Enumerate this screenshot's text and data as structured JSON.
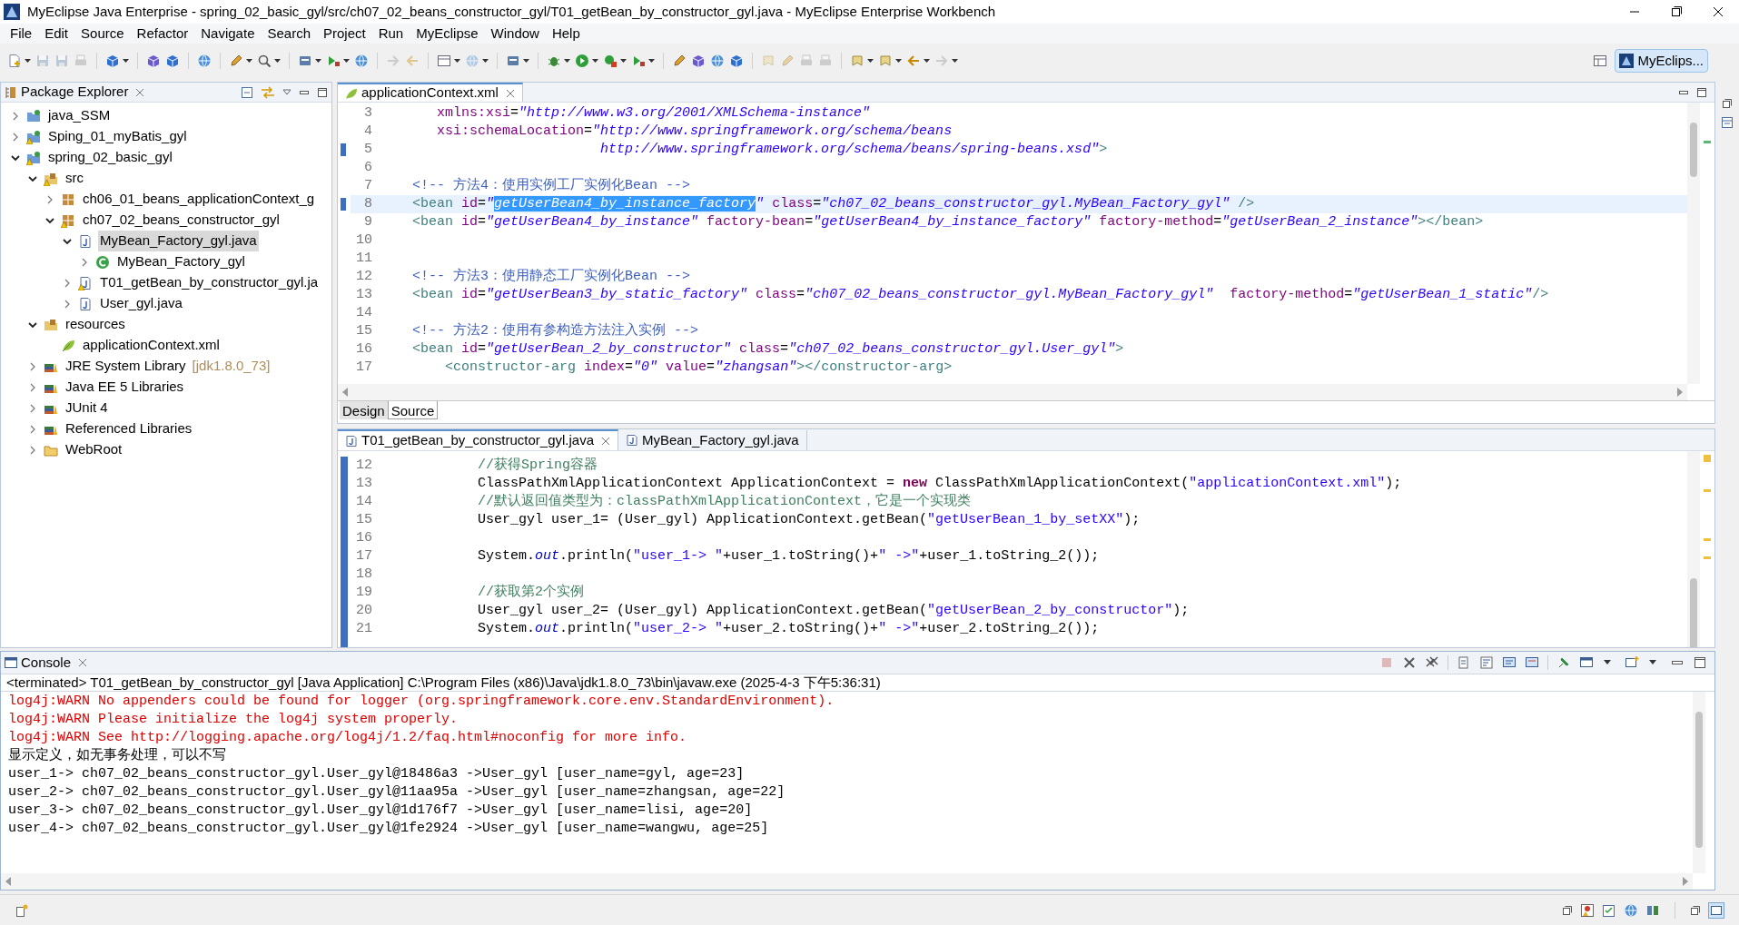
{
  "window": {
    "title": "MyEclipse Java Enterprise - spring_02_basic_gyl/src/ch07_02_beans_constructor_gyl/T01_getBean_by_constructor_gyl.java - MyEclipse Enterprise Workbench"
  },
  "menu": [
    "File",
    "Edit",
    "Source",
    "Refactor",
    "Navigate",
    "Search",
    "Project",
    "Run",
    "MyEclipse",
    "Window",
    "Help"
  ],
  "perspective": {
    "label": "MyEclips...",
    "selected": true
  },
  "package_explorer": {
    "title": "Package Explorer",
    "tree": [
      {
        "label": "java_SSM",
        "kind": "project",
        "warning": false,
        "expanded": false,
        "selected": false
      },
      {
        "label": "Sping_01_myBatis_gyl",
        "kind": "project",
        "warning": true,
        "expanded": false,
        "selected": false
      },
      {
        "label": "spring_02_basic_gyl",
        "kind": "project",
        "warning": true,
        "expanded": true,
        "selected": false,
        "children": [
          {
            "label": "src",
            "kind": "source_folder",
            "warning": true,
            "expanded": true,
            "selected": false,
            "children": [
              {
                "label": "ch06_01_beans_applicationContext_g",
                "kind": "package",
                "warning": false,
                "expanded": false,
                "selected": false
              },
              {
                "label": "ch07_02_beans_constructor_gyl",
                "kind": "package",
                "warning": true,
                "expanded": true,
                "selected": false,
                "children": [
                  {
                    "label": "MyBean_Factory_gyl.java",
                    "kind": "java_file",
                    "warning": false,
                    "expanded": true,
                    "selected": true,
                    "children": [
                      {
                        "label": "MyBean_Factory_gyl",
                        "kind": "class",
                        "warning": false,
                        "expanded": false,
                        "selected": false
                      }
                    ]
                  },
                  {
                    "label": "T01_getBean_by_constructor_gyl.ja",
                    "kind": "java_file",
                    "warning": true,
                    "expanded": false,
                    "selected": false
                  },
                  {
                    "label": "User_gyl.java",
                    "kind": "java_file",
                    "warning": false,
                    "expanded": false,
                    "selected": false
                  }
                ]
              }
            ]
          },
          {
            "label": "resources",
            "kind": "source_folder",
            "warning": false,
            "expanded": true,
            "selected": false,
            "children": [
              {
                "label": "applicationContext.xml",
                "kind": "xml_file",
                "warning": false,
                "selected": false
              }
            ]
          },
          {
            "label": "JRE System Library",
            "suffix": "[jdk1.8.0_73]",
            "kind": "library",
            "warning": false,
            "expanded": false,
            "selected": false
          },
          {
            "label": "Java EE 5 Libraries",
            "kind": "library",
            "warning": false,
            "expanded": false,
            "selected": false
          },
          {
            "label": "JUnit 4",
            "kind": "library",
            "warning": false,
            "expanded": false,
            "selected": false
          },
          {
            "label": "Referenced Libraries",
            "kind": "library",
            "warning": false,
            "expanded": false,
            "selected": false
          },
          {
            "label": "WebRoot",
            "kind": "folder",
            "warning": false,
            "expanded": false,
            "selected": false
          }
        ]
      }
    ]
  },
  "xml_editor": {
    "tab": {
      "label": "applicationContext.xml",
      "selected": true
    },
    "lines": [
      {
        "number": "3",
        "current": false,
        "marked": false,
        "tokens": [
          {
            "kind": "attr",
            "text": "       xmlns:xsi"
          },
          {
            "kind": "plain",
            "text": "="
          },
          {
            "kind": "string",
            "text": "\"http://www.w3.org/2001/XMLSchema-instance\""
          }
        ]
      },
      {
        "number": "4",
        "current": false,
        "marked": false,
        "tokens": [
          {
            "kind": "attr",
            "text": "       xsi:schemaLocation"
          },
          {
            "kind": "plain",
            "text": "="
          },
          {
            "kind": "string",
            "text": "\"http://www.springframework.org/schema/beans"
          }
        ]
      },
      {
        "number": "5",
        "current": false,
        "marked": true,
        "tokens": [
          {
            "kind": "string",
            "text": "                           http://www.springframework.org/schema/beans/spring-beans.xsd\""
          },
          {
            "kind": "tag",
            "text": ">"
          }
        ]
      },
      {
        "number": "6",
        "current": false,
        "marked": false
      },
      {
        "number": "7",
        "current": false,
        "marked": false,
        "tokens": [
          {
            "kind": "comment",
            "text": "    <!-- 方法4：使用实例工厂实例化Bean -->"
          }
        ]
      },
      {
        "number": "8",
        "current": true,
        "marked": true,
        "tokens": [
          {
            "kind": "tag",
            "text": "    <bean"
          },
          {
            "kind": "attr",
            "text": " id"
          },
          {
            "kind": "plain",
            "text": "="
          },
          {
            "kind": "string",
            "text": "\""
          },
          {
            "kind": "selection",
            "text": "getUserBean4_by_instance_factory"
          },
          {
            "kind": "string",
            "text": "\""
          },
          {
            "kind": "attr",
            "text": " class"
          },
          {
            "kind": "plain",
            "text": "="
          },
          {
            "kind": "string",
            "text": "\"ch07_02_beans_constructor_gyl.MyBean_Factory_gyl\""
          },
          {
            "kind": "tag",
            "text": " />"
          }
        ]
      },
      {
        "number": "9",
        "current": false,
        "marked": false,
        "tokens": [
          {
            "kind": "tag",
            "text": "    <bean"
          },
          {
            "kind": "attr",
            "text": " id"
          },
          {
            "kind": "plain",
            "text": "="
          },
          {
            "kind": "string",
            "text": "\"getUserBean4_by_instance\""
          },
          {
            "kind": "attr",
            "text": " factory-bean"
          },
          {
            "kind": "plain",
            "text": "="
          },
          {
            "kind": "string",
            "text": "\"getUserBean4_by_instance_factory\""
          },
          {
            "kind": "attr",
            "text": " factory-method"
          },
          {
            "kind": "plain",
            "text": "="
          },
          {
            "kind": "string",
            "text": "\"getUserBean_2_instance\""
          },
          {
            "kind": "tag",
            "text": "></bean>"
          }
        ]
      },
      {
        "number": "10",
        "current": false,
        "marked": false
      },
      {
        "number": "11",
        "current": false,
        "marked": false
      },
      {
        "number": "12",
        "current": false,
        "marked": false,
        "tokens": [
          {
            "kind": "comment",
            "text": "    <!-- 方法3：使用静态工厂实例化Bean -->"
          }
        ]
      },
      {
        "number": "13",
        "current": false,
        "marked": false,
        "tokens": [
          {
            "kind": "tag",
            "text": "    <bean"
          },
          {
            "kind": "attr",
            "text": " id"
          },
          {
            "kind": "plain",
            "text": "="
          },
          {
            "kind": "string",
            "text": "\"getUserBean3_by_static_factory\""
          },
          {
            "kind": "attr",
            "text": " class"
          },
          {
            "kind": "plain",
            "text": "="
          },
          {
            "kind": "string",
            "text": "\"ch07_02_beans_constructor_gyl.MyBean_Factory_gyl\""
          },
          {
            "kind": "attr",
            "text": "  factory-method"
          },
          {
            "kind": "plain",
            "text": "="
          },
          {
            "kind": "string",
            "text": "\"getUserBean_1_static\""
          },
          {
            "kind": "tag",
            "text": "/>"
          }
        ]
      },
      {
        "number": "14",
        "current": false,
        "marked": false
      },
      {
        "number": "15",
        "current": false,
        "marked": false,
        "tokens": [
          {
            "kind": "comment",
            "text": "    <!-- 方法2：使用有参构造方法注入实例 -->"
          }
        ]
      },
      {
        "number": "16",
        "current": false,
        "marked": false,
        "tokens": [
          {
            "kind": "tag",
            "text": "    <bean"
          },
          {
            "kind": "attr",
            "text": " id"
          },
          {
            "kind": "plain",
            "text": "="
          },
          {
            "kind": "string",
            "text": "\"getUserBean_2_by_constructor\""
          },
          {
            "kind": "attr",
            "text": " class"
          },
          {
            "kind": "plain",
            "text": "="
          },
          {
            "kind": "string",
            "text": "\"ch07_02_beans_constructor_gyl.User_gyl\""
          },
          {
            "kind": "tag",
            "text": ">"
          }
        ]
      },
      {
        "number": "17",
        "current": false,
        "marked": false,
        "tokens": [
          {
            "kind": "tag",
            "text": "        <constructor-arg"
          },
          {
            "kind": "attr",
            "text": " index"
          },
          {
            "kind": "plain",
            "text": "="
          },
          {
            "kind": "string",
            "text": "\"0\""
          },
          {
            "kind": "attr",
            "text": " value"
          },
          {
            "kind": "plain",
            "text": "="
          },
          {
            "kind": "string",
            "text": "\"zhangsan\""
          },
          {
            "kind": "tag",
            "text": "></constructor-arg>"
          }
        ]
      }
    ],
    "bottom_tabs": [
      {
        "label": "Design",
        "selected": false
      },
      {
        "label": "Source",
        "selected": true
      }
    ]
  },
  "java_editor": {
    "tabs": [
      {
        "label": "T01_getBean_by_constructor_gyl.java",
        "selected": true
      },
      {
        "label": "MyBean_Factory_gyl.java",
        "selected": false
      }
    ],
    "lines": [
      {
        "number": "12",
        "tokens": [
          {
            "kind": "comment",
            "text": "            //获得Spring容器"
          }
        ]
      },
      {
        "number": "13",
        "tokens": [
          {
            "kind": "plain",
            "text": "            ClassPathXmlApplicationContext ApplicationContext = "
          },
          {
            "kind": "keyword",
            "text": "new"
          },
          {
            "kind": "plain",
            "text": " ClassPathXmlApplicationContext("
          },
          {
            "kind": "string",
            "text": "\"applicationContext.xml\""
          },
          {
            "kind": "plain",
            "text": ");"
          }
        ]
      },
      {
        "number": "14",
        "tokens": [
          {
            "kind": "comment",
            "text": "            //默认返回值类型为：classPathXmlApplicationContext，它是一个实现类"
          }
        ]
      },
      {
        "number": "15",
        "tokens": [
          {
            "kind": "plain",
            "text": "            User_gyl user_1= (User_gyl) ApplicationContext.getBean("
          },
          {
            "kind": "string",
            "text": "\"getUserBean_1_by_setXX\""
          },
          {
            "kind": "plain",
            "text": ");"
          }
        ]
      },
      {
        "number": "16"
      },
      {
        "number": "17",
        "tokens": [
          {
            "kind": "plain",
            "text": "            System."
          },
          {
            "kind": "field",
            "text": "out"
          },
          {
            "kind": "plain",
            "text": ".println("
          },
          {
            "kind": "string",
            "text": "\"user_1-> \""
          },
          {
            "kind": "plain",
            "text": "+user_1.toString()+"
          },
          {
            "kind": "string",
            "text": "\" ->\""
          },
          {
            "kind": "plain",
            "text": "+user_1.toString_2());"
          }
        ]
      },
      {
        "number": "18"
      },
      {
        "number": "19",
        "tokens": [
          {
            "kind": "comment",
            "text": "            //获取第2个实例"
          }
        ]
      },
      {
        "number": "20",
        "tokens": [
          {
            "kind": "plain",
            "text": "            User_gyl user_2= (User_gyl) ApplicationContext.getBean("
          },
          {
            "kind": "string",
            "text": "\"getUserBean_2_by_constructor\""
          },
          {
            "kind": "plain",
            "text": ");"
          }
        ]
      },
      {
        "number": "21",
        "tokens": [
          {
            "kind": "plain",
            "text": "            System."
          },
          {
            "kind": "field",
            "text": "out"
          },
          {
            "kind": "plain",
            "text": ".println("
          },
          {
            "kind": "string",
            "text": "\"user_2-> \""
          },
          {
            "kind": "plain",
            "text": "+user_2.toString()+"
          },
          {
            "kind": "string",
            "text": "\" ->\""
          },
          {
            "kind": "plain",
            "text": "+user_2.toString_2());"
          }
        ]
      }
    ]
  },
  "console": {
    "title": "Console",
    "status": "<terminated> T01_getBean_by_constructor_gyl [Java Application] C:\\Program Files (x86)\\Java\\jdk1.8.0_73\\bin\\javaw.exe (2025-4-3 下午5:36:31)",
    "lines": [
      {
        "kind": "error",
        "text": "log4j:WARN No appenders could be found for logger (org.springframework.core.env.StandardEnvironment)."
      },
      {
        "kind": "error",
        "text": "log4j:WARN Please initialize the log4j system properly."
      },
      {
        "kind": "error",
        "text": "log4j:WARN See http://logging.apache.org/log4j/1.2/faq.html#noconfig for more info."
      },
      {
        "kind": "output",
        "text": "显示定义，如无事务处理，可以不写"
      },
      {
        "kind": "output",
        "text": "user_1-> ch07_02_beans_constructor_gyl.User_gyl@18486a3 ->User_gyl [user_name=gyl, age=23]"
      },
      {
        "kind": "output",
        "text": "user_2-> ch07_02_beans_constructor_gyl.User_gyl@11aa95a ->User_gyl [user_name=zhangsan, age=22]"
      },
      {
        "kind": "output",
        "text": "user_3-> ch07_02_beans_constructor_gyl.User_gyl@1d176f7 ->User_gyl [user_name=lisi, age=20]"
      },
      {
        "kind": "output",
        "text": "user_4-> ch07_02_beans_constructor_gyl.User_gyl@1fe2924 ->User_gyl [user_name=wangwu, age=25]"
      }
    ]
  }
}
